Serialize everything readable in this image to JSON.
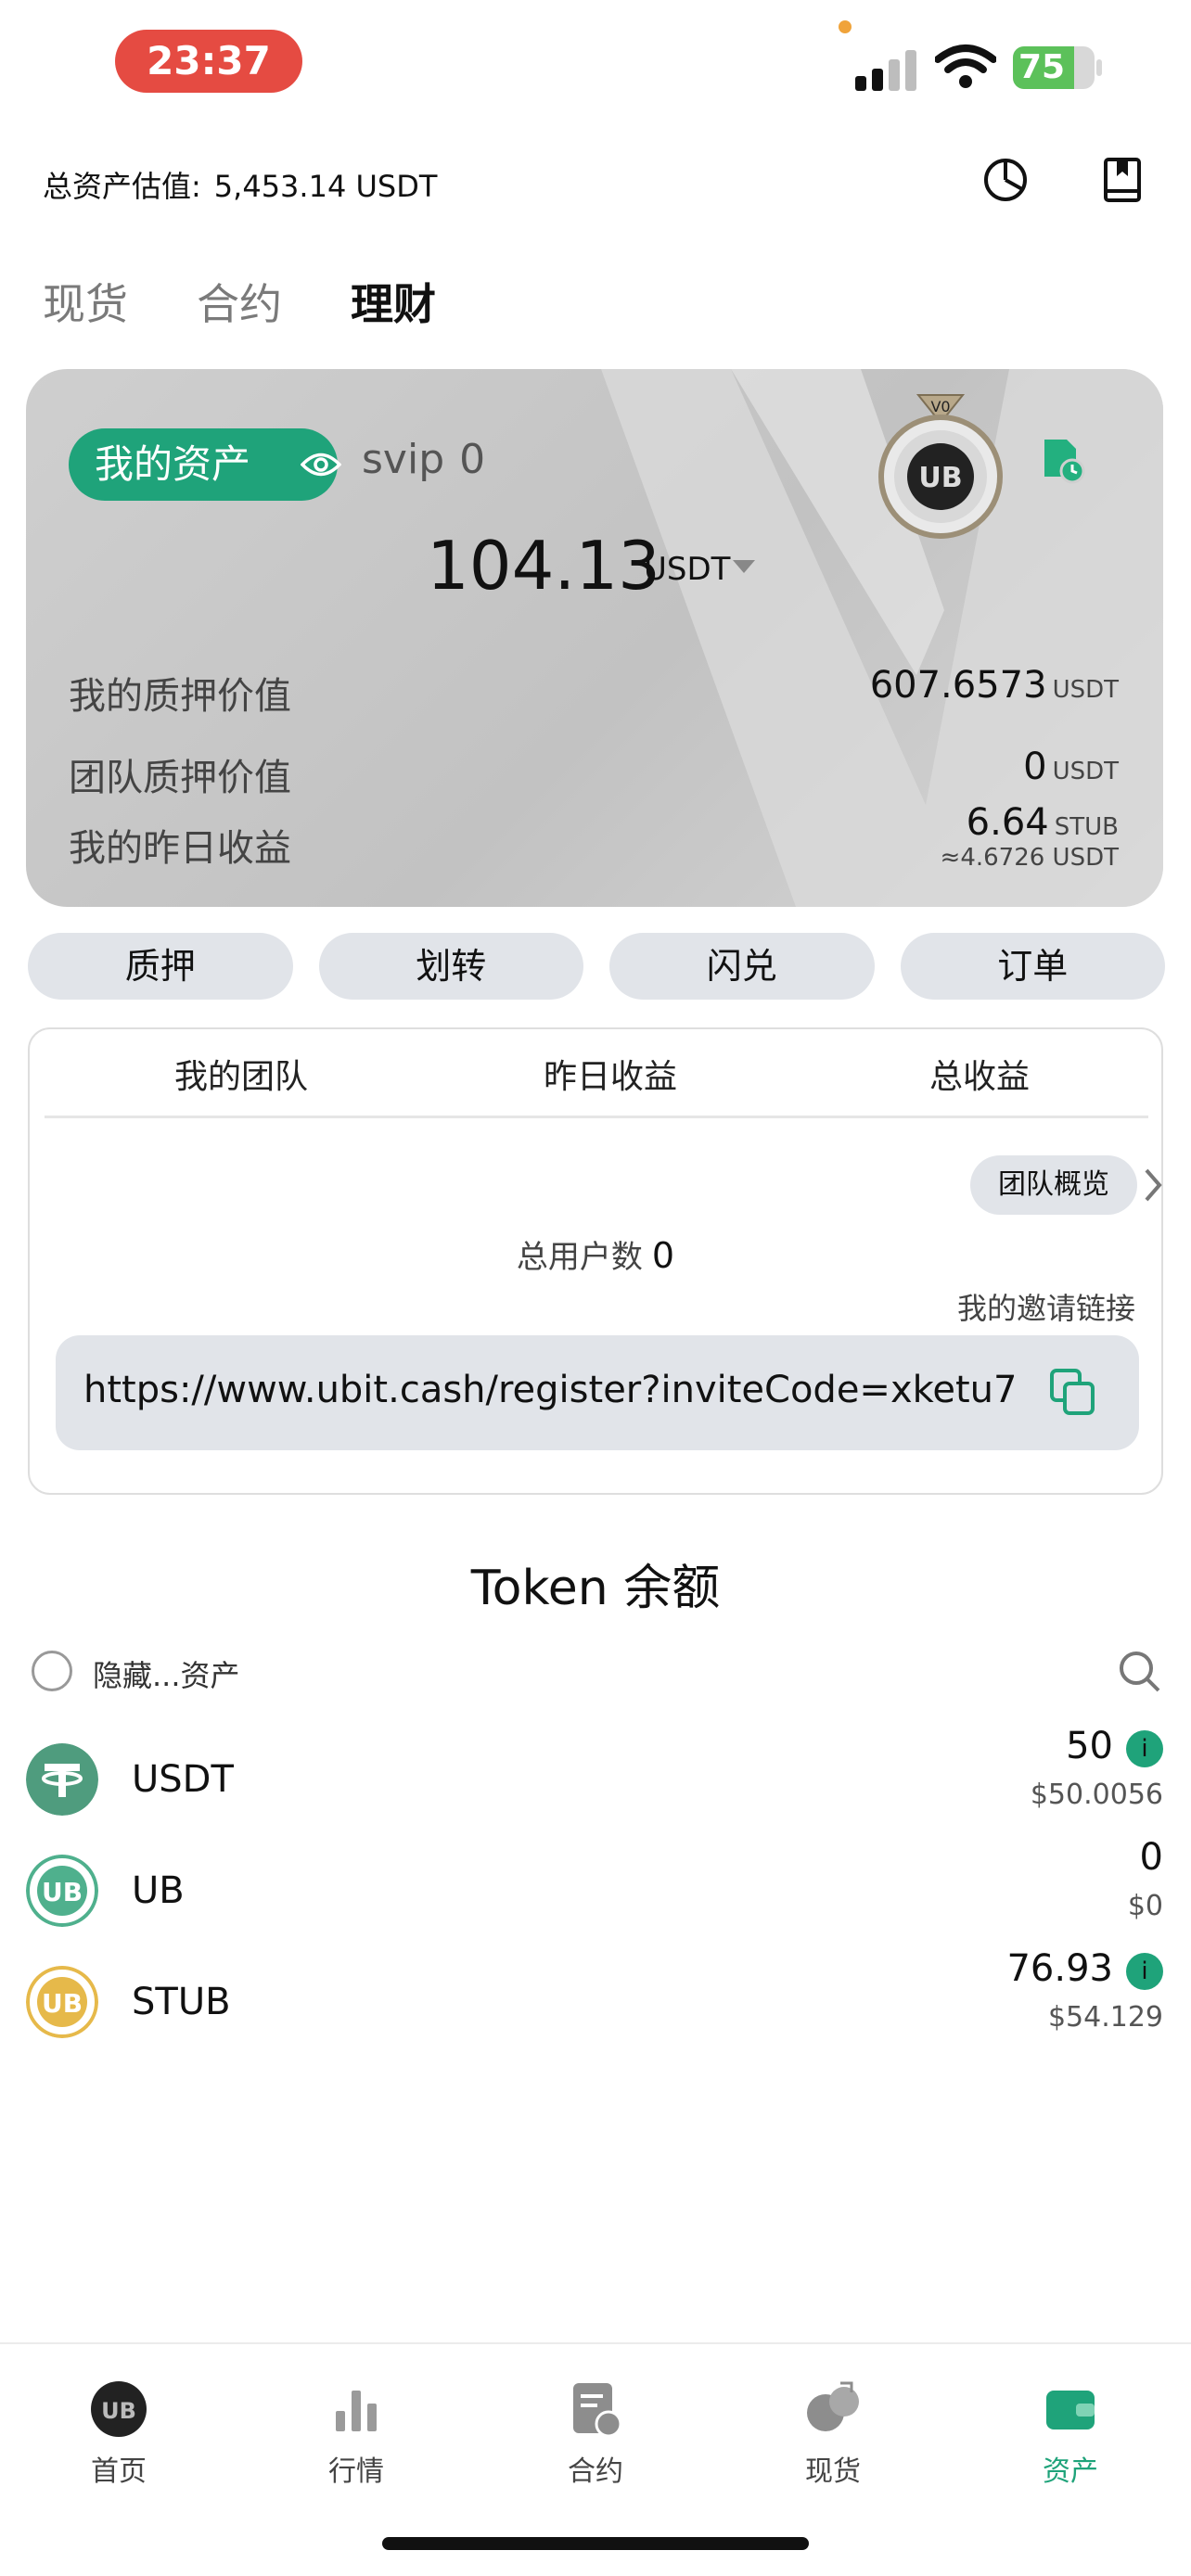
{
  "status_bar": {
    "time": "23:37",
    "battery": "75",
    "battery_level": 0.75,
    "colors": {
      "time_pill": "#e54b42",
      "battery": "#5cc15a"
    }
  },
  "header": {
    "total_label": "总资产估值:",
    "total_value": "5,453.14 USDT",
    "icons": [
      "pie-chart-icon",
      "book-icon"
    ]
  },
  "tabs": [
    {
      "label": "现货",
      "active": false
    },
    {
      "label": "合约",
      "active": false
    },
    {
      "label": "理财",
      "active": true
    }
  ],
  "asset_card": {
    "my_assets_label": "我的资产",
    "svip_label": "svip",
    "svip_level": "0",
    "badge_level": "V0",
    "badge_logo": "UB",
    "amount": "104.13",
    "amount_unit": "USDT",
    "rows": [
      {
        "label": "我的质押价值",
        "value": "607.6573",
        "unit": "USDT"
      },
      {
        "label": "团队质押价值",
        "value": "0",
        "unit": "USDT"
      },
      {
        "label": "我的昨日收益",
        "value": "6.64",
        "unit": "STUB",
        "sub": "≈4.6726 USDT"
      }
    ]
  },
  "actions": [
    "质押",
    "划转",
    "闪兑",
    "订单"
  ],
  "team": {
    "tabs": [
      "我的团队",
      "昨日收益",
      "总收益"
    ],
    "overview_button": "团队概览",
    "users_label": "总用户数",
    "users_count": "0",
    "invite_label": "我的邀请链接",
    "invite_url": "https://www.ubit.cash/register?inviteCode=xketu7"
  },
  "tokens_section": {
    "title": "Token 余额",
    "hide_label": "隐藏...资产",
    "info_glyph": "i",
    "tokens": [
      {
        "name": "USDT",
        "amount": "50",
        "usd": "$50.0056",
        "icon": "tether-icon",
        "has_info": true
      },
      {
        "name": "UB",
        "amount": "0",
        "usd": "$0",
        "icon": "ub-coin-icon",
        "has_info": false
      },
      {
        "name": "STUB",
        "amount": "76.93",
        "usd": "$54.129",
        "icon": "stub-coin-icon",
        "has_info": true
      }
    ]
  },
  "bottom_nav": [
    {
      "label": "首页",
      "icon": "home-ub-icon",
      "active": false
    },
    {
      "label": "行情",
      "icon": "bar-chart-icon",
      "active": false
    },
    {
      "label": "合约",
      "icon": "contract-doc-icon",
      "active": false
    },
    {
      "label": "现货",
      "icon": "spot-coins-icon",
      "active": false
    },
    {
      "label": "资产",
      "icon": "wallet-icon",
      "active": true
    }
  ],
  "colors": {
    "accent": "#1fa37a",
    "pill_bg": "#e1e4e9"
  }
}
